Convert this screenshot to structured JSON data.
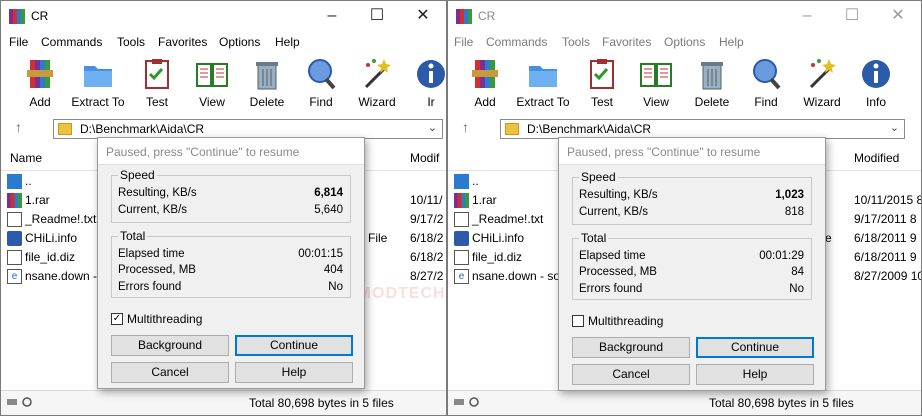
{
  "app": {
    "icon": "winrar-icon",
    "window_controls": {
      "minimize": "–",
      "maximize": "☐",
      "close": "✕"
    },
    "menu": [
      "File",
      "Commands",
      "Tools",
      "Favorites",
      "Options",
      "Help"
    ]
  },
  "left": {
    "title": "CR",
    "toolbar": [
      "Add",
      "Extract To",
      "Test",
      "View",
      "Delete",
      "Find",
      "Wizard",
      "Ir"
    ],
    "path": "D:\\Benchmark\\Aida\\CR",
    "col_name": "Name",
    "col_modified": "Modif",
    "files": [
      {
        "name": "..",
        "icon": "folder-up-icon",
        "modified": ""
      },
      {
        "name": "1.rar",
        "icon": "rar-file-icon",
        "modified": "10/11/"
      },
      {
        "name": "_Readme!.txt",
        "icon": "text-file-icon",
        "modified": "9/17/2"
      },
      {
        "name": "CHiLi.info",
        "icon": "info-file-icon",
        "modified": "6/18/2"
      },
      {
        "name": "file_id.diz",
        "icon": "file-icon",
        "modified": "6/18/2"
      },
      {
        "name": "nsane.down -",
        "icon": "web-file-icon",
        "modified": "8/27/2"
      }
    ],
    "type_fragment": "File",
    "status_total": "Total 80,698 bytes in 5 files",
    "dialog": {
      "title": "Paused, press \"Continue\" to resume",
      "speed_group": "Speed",
      "resulting_label": "Resulting, KB/s",
      "resulting_value": "6,814",
      "current_label": "Current, KB/s",
      "current_value": "5,640",
      "total_group": "Total",
      "elapsed_label": "Elapsed time",
      "elapsed_value": "00:01:15",
      "processed_label": "Processed, MB",
      "processed_value": "404",
      "errors_label": "Errors found",
      "errors_value": "No",
      "multithreading_label": "Multithreading",
      "multithreading_checked": true,
      "btn_background": "Background",
      "btn_continue": "Continue",
      "btn_cancel": "Cancel",
      "btn_help": "Help"
    }
  },
  "right": {
    "title": "CR",
    "toolbar": [
      "Add",
      "Extract To",
      "Test",
      "View",
      "Delete",
      "Find",
      "Wizard",
      "Info"
    ],
    "path": "D:\\Benchmark\\Aida\\CR",
    "col_modified": "Modified",
    "files": [
      {
        "name": "..",
        "icon": "folder-up-icon",
        "modified": ""
      },
      {
        "name": "1.rar",
        "icon": "rar-file-icon",
        "modified": "10/11/2015 8"
      },
      {
        "name": "_Readme!.txt",
        "icon": "text-file-icon",
        "modified": "9/17/2011 8"
      },
      {
        "name": "CHiLi.info",
        "icon": "info-file-icon",
        "modified": "6/18/2011 9"
      },
      {
        "name": "file_id.diz",
        "icon": "file-icon",
        "modified": "6/18/2011 9"
      },
      {
        "name": "nsane.down - so",
        "icon": "web-file-icon",
        "modified": "8/27/2009 10"
      }
    ],
    "type_fragment": "e",
    "status_total": "Total 80,698 bytes in 5 files",
    "dialog": {
      "title": "Paused, press \"Continue\" to resume",
      "speed_group": "Speed",
      "resulting_label": "Resulting, KB/s",
      "resulting_value": "1,023",
      "current_label": "Current, KB/s",
      "current_value": "818",
      "total_group": "Total",
      "elapsed_label": "Elapsed time",
      "elapsed_value": "00:01:29",
      "processed_label": "Processed, MB",
      "processed_value": "84",
      "errors_label": "Errors found",
      "errors_value": "No",
      "multithreading_label": "Multithreading",
      "multithreading_checked": false,
      "btn_background": "Background",
      "btn_continue": "Continue",
      "btn_cancel": "Cancel",
      "btn_help": "Help"
    }
  },
  "watermark": "VMODTECH.COM",
  "colors": {
    "accent": "#0078d7",
    "dialog_bg": "#f0f0f0"
  }
}
